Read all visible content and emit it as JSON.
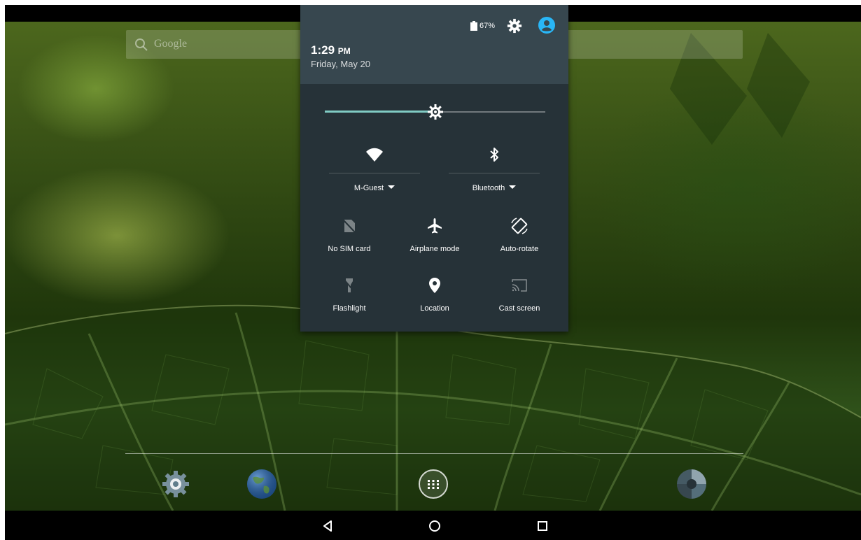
{
  "home": {
    "search_label": "Google",
    "dock": [
      {
        "name": "settings-app-icon"
      },
      {
        "name": "browser-app-icon"
      },
      {
        "name": "all-apps-icon"
      },
      {
        "name": "camera-app-icon"
      }
    ]
  },
  "quick_settings": {
    "battery_percent": "67%",
    "time": "1:29",
    "time_suffix": "PM",
    "date": "Friday, May 20",
    "brightness_level": 0.5,
    "wifi": {
      "label": "M-Guest"
    },
    "bluetooth": {
      "label": "Bluetooth"
    },
    "tiles": [
      {
        "label": "No SIM card",
        "icon": "no-sim-icon"
      },
      {
        "label": "Airplane mode",
        "icon": "airplane-icon"
      },
      {
        "label": "Auto-rotate",
        "icon": "auto-rotate-icon"
      },
      {
        "label": "Flashlight",
        "icon": "flashlight-icon"
      },
      {
        "label": "Location",
        "icon": "location-icon"
      },
      {
        "label": "Cast screen",
        "icon": "cast-icon"
      }
    ]
  },
  "navbar": {
    "buttons": [
      {
        "name": "back-icon"
      },
      {
        "name": "home-icon"
      },
      {
        "name": "recents-icon"
      }
    ]
  },
  "colors": {
    "panel_bg": "#263238",
    "header_bg": "#37474f",
    "accent": "#80cbc4",
    "user_accent": "#29b6f6"
  }
}
